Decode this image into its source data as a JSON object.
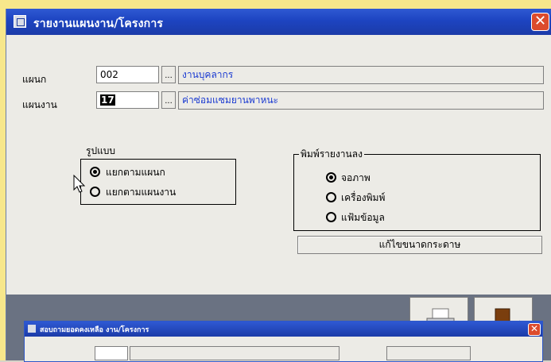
{
  "window": {
    "title": "รายงานแผนงาน/โครงการ",
    "close_label": "✕"
  },
  "form": {
    "department_label": "แผนก",
    "department_code": "002",
    "department_name": "งานบุคลากร",
    "plan_label": "แผนงาน",
    "plan_code": "17",
    "plan_name": "ค่าซ่อมแซมยานพาหนะ",
    "lookup_label": "..."
  },
  "format_group": {
    "caption": "รูปแบบ",
    "options": [
      {
        "label": "แยกตามแผนก",
        "checked": true
      },
      {
        "label": "แยกตามแผนงาน",
        "checked": false
      }
    ]
  },
  "print_group": {
    "caption": "พิมพ์รายงานลง",
    "options": [
      {
        "label": "จอภาพ",
        "checked": true
      },
      {
        "label": "เครื่องพิมพ์",
        "checked": false
      },
      {
        "label": "แฟ้มข้อมูล",
        "checked": false
      }
    ]
  },
  "buttons": {
    "paper_size": "แก้ไขขนาดกระดาษ"
  },
  "child_window": {
    "title": "สอบถามยอดคงเหลือ งาน/โครงการ",
    "close_label": "✕"
  },
  "icons": {
    "window_icon": "app-icon",
    "printer": "printer-icon",
    "exit": "exit-door-icon"
  }
}
